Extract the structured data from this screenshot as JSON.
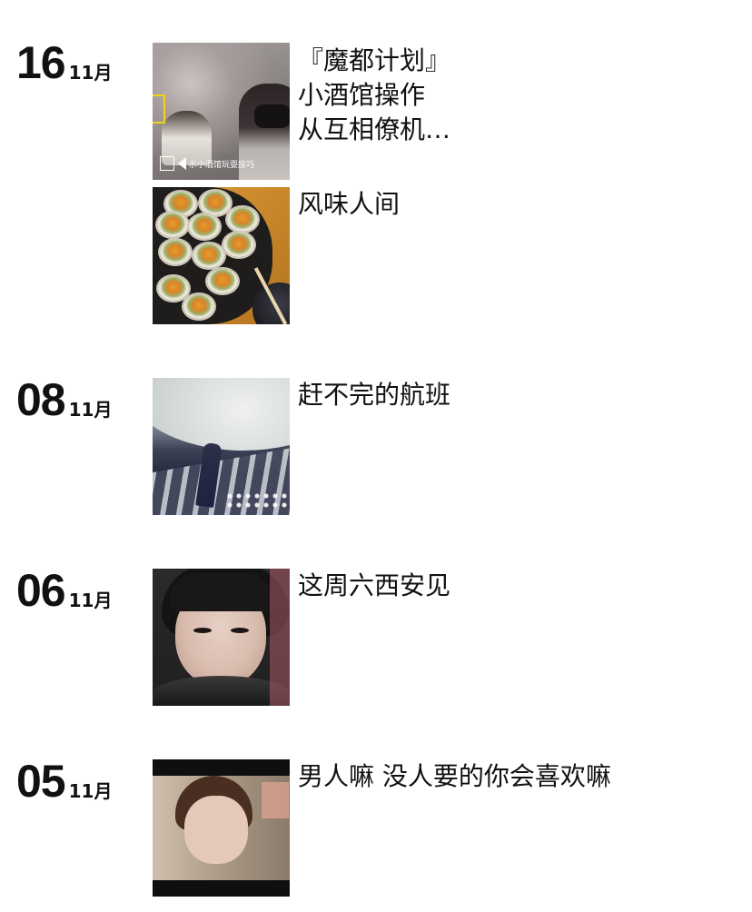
{
  "entries": [
    {
      "day": "16",
      "month": "11月",
      "items": [
        {
          "caption": "『魔都计划』\n小酒馆操作\n从互相僚机…",
          "thumb_icon": "video-still",
          "thumb_subtitle": "示小酒馆玩耍技巧"
        },
        {
          "caption": "风味人间",
          "thumb_icon": "oysters-photo"
        }
      ]
    },
    {
      "day": "08",
      "month": "11月",
      "items": [
        {
          "caption": "赶不完的航班",
          "thumb_icon": "airport-photo"
        }
      ]
    },
    {
      "day": "06",
      "month": "11月",
      "items": [
        {
          "caption": "这周六西安见",
          "thumb_icon": "portrait-photo"
        }
      ]
    },
    {
      "day": "05",
      "month": "11月",
      "items": [
        {
          "caption": "男人嘛 没人要的你会喜欢嘛",
          "thumb_icon": "movie-still"
        }
      ]
    }
  ]
}
